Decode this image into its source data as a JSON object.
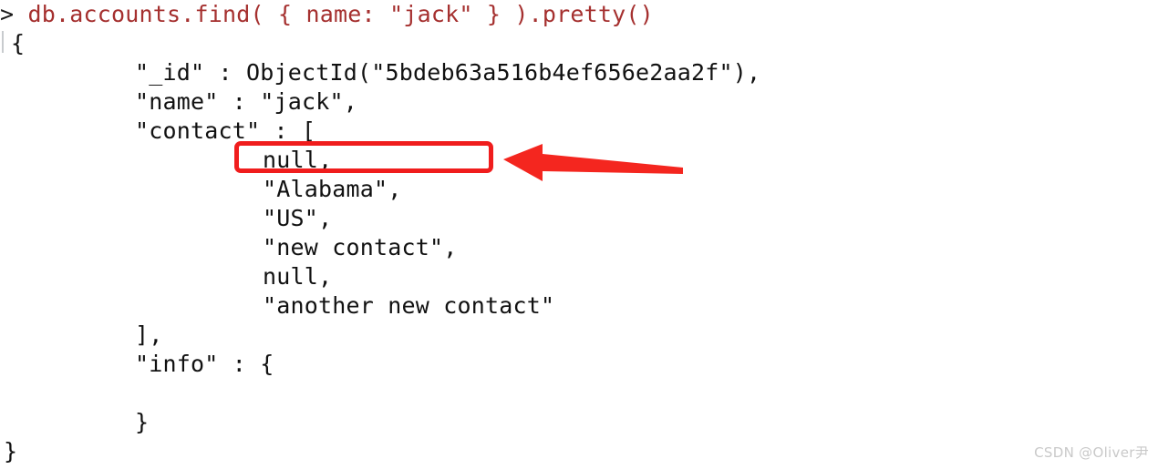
{
  "app": {
    "kind": "mongodb-shell-output",
    "background_color": "#ffffff"
  },
  "colors": {
    "command_text": "#a5302f",
    "output_text": "#111111",
    "annotation_red": "#f01d1d",
    "watermark": "#c9c9c9"
  },
  "terminal": {
    "prompt_symbol": ">",
    "command": "db.accounts.find( { name: \"jack\" } ).pretty()",
    "output_lines": [
      {
        "indent": 0,
        "text": "{"
      },
      {
        "indent": 148,
        "text": "\"_id\" : ObjectId(\"5bdeb63a516b4ef656e2aa2f\"),"
      },
      {
        "indent": 148,
        "text": "\"name\" : \"jack\","
      },
      {
        "indent": 148,
        "text": "\"contact\" : ["
      },
      {
        "indent": 288,
        "text": "null,"
      },
      {
        "indent": 288,
        "text": "\"Alabama\","
      },
      {
        "indent": 288,
        "text": "\"US\","
      },
      {
        "indent": 288,
        "text": "\"new contact\","
      },
      {
        "indent": 288,
        "text": "null,"
      },
      {
        "indent": 288,
        "text": "\"another new contact\""
      },
      {
        "indent": 148,
        "text": "],"
      },
      {
        "indent": 148,
        "text": "\"info\" : {"
      },
      {
        "indent": 148,
        "text": "}"
      },
      {
        "indent": 0,
        "text": "}"
      }
    ]
  },
  "annotations": {
    "highlight_box": {
      "target_text": "null,",
      "border_color": "#f01d1d"
    },
    "arrow": {
      "direction": "left",
      "color": "#f01d1d",
      "points_to": "null,"
    }
  },
  "watermark": {
    "text": "CSDN @Oliver尹"
  }
}
